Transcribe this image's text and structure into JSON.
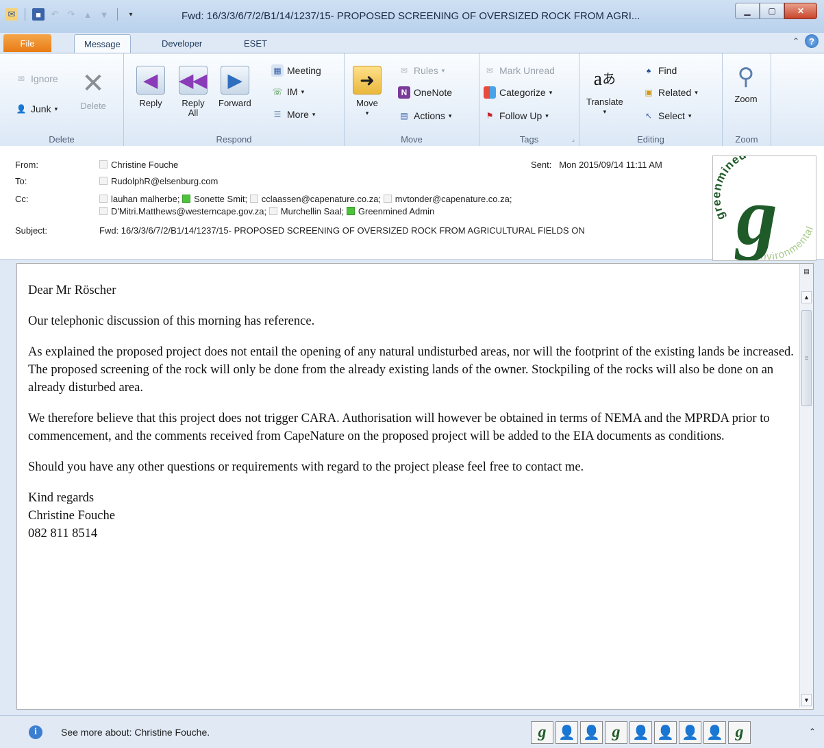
{
  "window": {
    "title": "Fwd: 16/3/3/6/7/2/B1/14/1237/15- PROPOSED SCREENING OF OVERSIZED ROCK FROM AGRI..."
  },
  "tabs": [
    "File",
    "Message",
    "Developer",
    "ESET"
  ],
  "ribbon": {
    "delete_group": {
      "label": "Delete",
      "ignore": "Ignore",
      "junk": "Junk",
      "delete": "Delete"
    },
    "respond_group": {
      "label": "Respond",
      "reply": "Reply",
      "reply_all": "Reply All",
      "forward": "Forward",
      "meeting": "Meeting",
      "im": "IM",
      "more": "More"
    },
    "move_group": {
      "label": "Move",
      "move": "Move",
      "rules": "Rules",
      "onenote": "OneNote",
      "actions": "Actions"
    },
    "tags_group": {
      "label": "Tags",
      "mark_unread": "Mark Unread",
      "categorize": "Categorize",
      "follow_up": "Follow Up"
    },
    "editing_group": {
      "label": "Editing",
      "translate": "Translate",
      "find": "Find",
      "related": "Related",
      "select": "Select"
    },
    "zoom_group": {
      "label": "Zoom",
      "zoom": "Zoom"
    }
  },
  "header": {
    "from_label": "From:",
    "from": "Christine Fouche",
    "to_label": "To:",
    "to": "RudolphR@elsenburg.com",
    "cc_label": "Cc:",
    "cc_line1": [
      {
        "name": "lauhan malherbe;",
        "status": "none"
      },
      {
        "name": "Sonette Smit;",
        "status": "green"
      },
      {
        "name": "cclaassen@capenature.co.za;",
        "status": "none"
      },
      {
        "name": "mvtonder@capenature.co.za;",
        "status": "none"
      }
    ],
    "cc_line2": [
      {
        "name": "D'Mitri.Matthews@westerncape.gov.za;",
        "status": "none"
      },
      {
        "name": "Murchellin Saal;",
        "status": "none"
      },
      {
        "name": "Greenmined Admin",
        "status": "green"
      }
    ],
    "subject_label": "Subject:",
    "subject": "Fwd: 16/3/3/6/7/2/B1/14/1237/15- PROPOSED SCREENING OF OVERSIZED ROCK FROM AGRICULTURAL FIELDS ON",
    "sent_label": "Sent:",
    "sent": "Mon 2015/09/14 11:11 AM"
  },
  "logo": {
    "top_text": "greenmined",
    "bottom_text": "environmental",
    "letter": "g"
  },
  "body": {
    "greeting": "Dear Mr Röscher",
    "paragraphs": [
      "Our telephonic discussion of this morning has reference.",
      "As explained the proposed project does not entail the opening of any natural undisturbed areas, nor will the footprint of the existing lands be increased. The proposed screening of the rock will only be done from the already existing lands of the owner. Stockpiling of the rocks will also be done on an already disturbed area.",
      "We therefore believe that this project does not trigger CARA. Authorisation will however be obtained in terms of NEMA and the MPRDA prior to commencement, and the comments received from CapeNature on the proposed project will be added to the EIA documents as conditions.",
      "Should you have any other questions or requirements with regard to the project please feel free to contact me."
    ],
    "closing": "Kind regards",
    "signature_name": "Christine Fouche",
    "signature_phone": "082 811 8514"
  },
  "people_pane": {
    "see_more": "See more about: Christine Fouche.",
    "pictures": [
      "g",
      "person",
      "person",
      "g",
      "person",
      "person",
      "person",
      "person",
      "g"
    ]
  },
  "colors": {
    "accent": "#e97b15",
    "presence_online": "#4cc43a",
    "logo_green": "#1f5b28"
  }
}
